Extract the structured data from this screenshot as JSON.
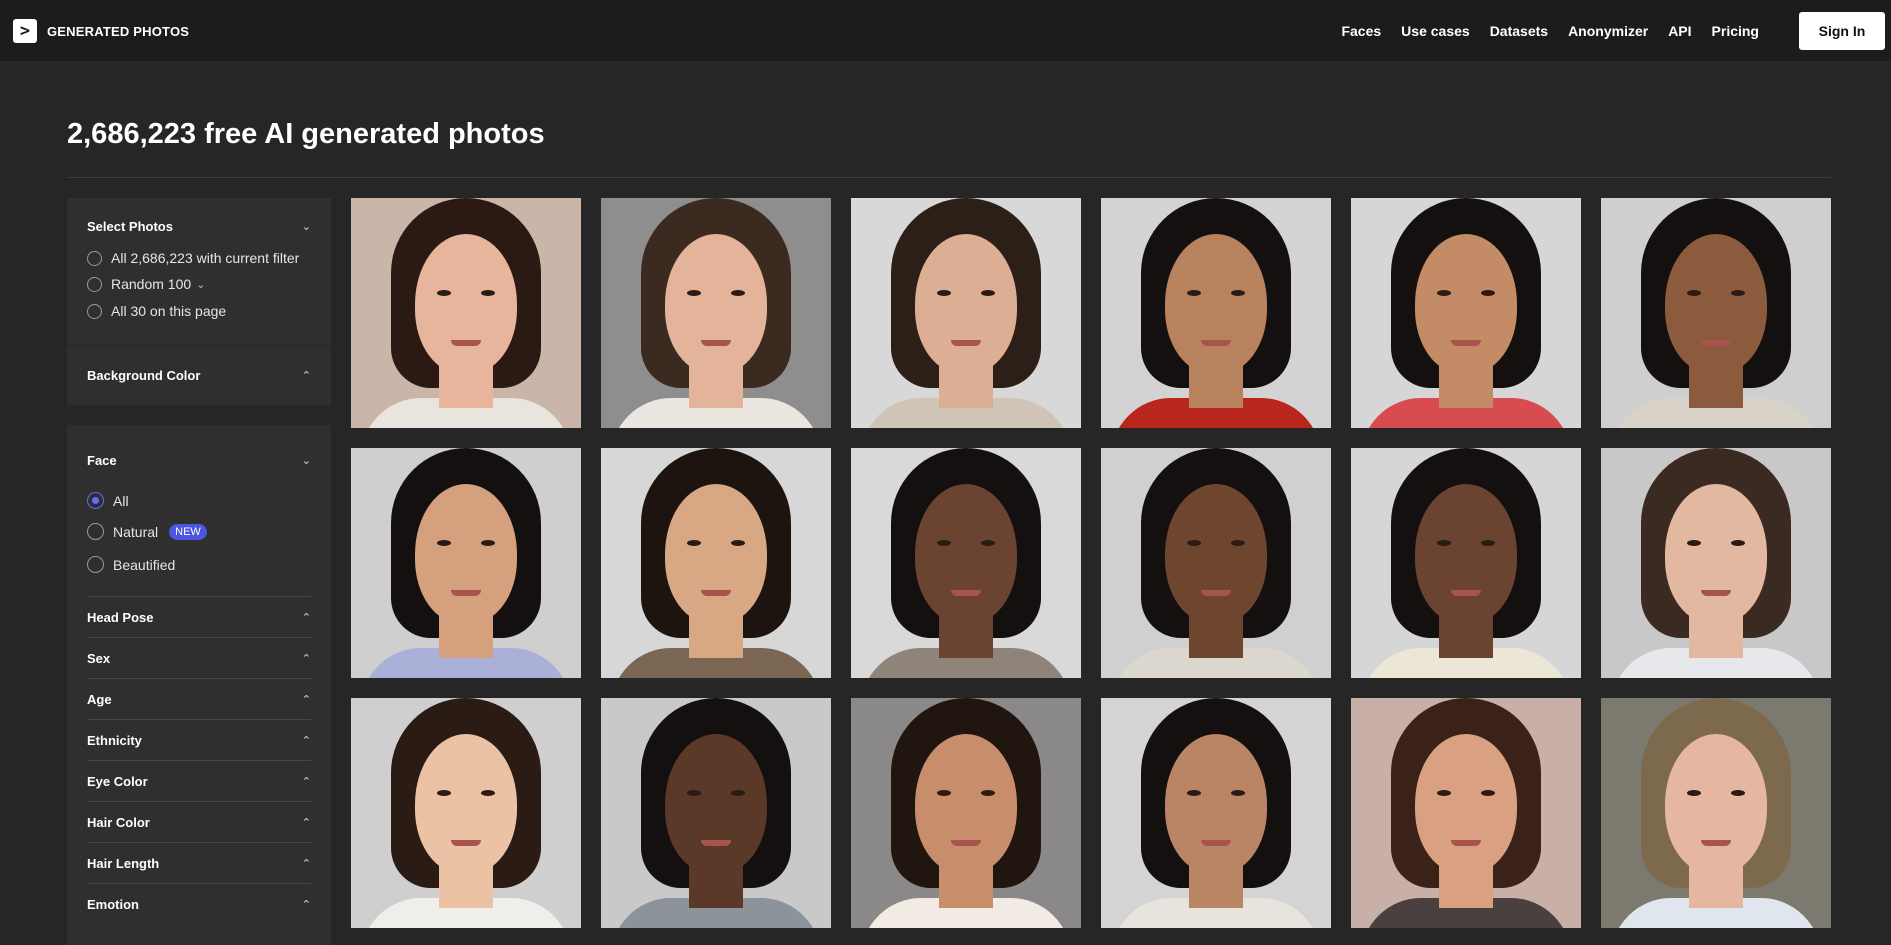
{
  "header": {
    "logo_symbol": ">",
    "logo_text": "GENERATED PHOTOS",
    "nav": [
      "Faces",
      "Use cases",
      "Datasets",
      "Anonymizer",
      "API",
      "Pricing"
    ],
    "signin_label": "Sign In"
  },
  "main": {
    "title": "2,686,223 free AI generated photos"
  },
  "sidebar": {
    "select_photos": {
      "title": "Select Photos",
      "options": [
        "All 2,686,223 with current filter",
        "Random 100",
        "All 30 on this page"
      ]
    },
    "background_color": {
      "title": "Background Color"
    },
    "face": {
      "title": "Face",
      "options": [
        "All",
        "Natural",
        "Beautified"
      ],
      "selected": "All",
      "new_badge": "NEW"
    },
    "filters": [
      "Head Pose",
      "Sex",
      "Age",
      "Ethnicity",
      "Eye Color",
      "Hair Color",
      "Hair Length",
      "Emotion"
    ]
  },
  "colors": {
    "background": "#262626",
    "topbar": "#1c1c1c",
    "panel": "#2f2f2f",
    "accent": "#5b6cff"
  },
  "photos": [
    {
      "bg": "#c9b6a8",
      "hair": "#2b1a14",
      "skin": "#e7b59c",
      "shirt": "#e9e4de"
    },
    {
      "bg": "#8e8e8e",
      "hair": "#3a2a20",
      "skin": "#e4b49a",
      "shirt": "#ebe6df"
    },
    {
      "bg": "#d8d8d8",
      "hair": "#2b1f18",
      "skin": "#dcae94",
      "shirt": "#cfc4b5"
    },
    {
      "bg": "#d3d3d3",
      "hair": "#141010",
      "skin": "#b8825f",
      "shirt": "#b8261d"
    },
    {
      "bg": "#d6d6d6",
      "hair": "#141010",
      "skin": "#c48c66",
      "shirt": "#d84b4f"
    },
    {
      "bg": "#cfcfcf",
      "hair": "#141010",
      "skin": "#8c5a3c",
      "shirt": "#d9d2c8"
    },
    {
      "bg": "#cfcfcf",
      "hair": "#141010",
      "skin": "#d4a07e",
      "shirt": "#aab0d8"
    },
    {
      "bg": "#d7d7d7",
      "hair": "#1d1410",
      "skin": "#d8a885",
      "shirt": "#7b6654"
    },
    {
      "bg": "#d9d9d9",
      "hair": "#141010",
      "skin": "#6b4431",
      "shirt": "#8f8479"
    },
    {
      "bg": "#d0d0d0",
      "hair": "#141010",
      "skin": "#6e4630",
      "shirt": "#dcd8d0"
    },
    {
      "bg": "#d6d6d6",
      "hair": "#141010",
      "skin": "#6a4331",
      "shirt": "#ece6d6"
    },
    {
      "bg": "#c8c8c8",
      "hair": "#3b2a22",
      "skin": "#e3b8a0",
      "shirt": "#e7e8ec"
    },
    {
      "bg": "#cfcfcf",
      "hair": "#2a1b14",
      "skin": "#ecc2a5",
      "shirt": "#f0eeea"
    },
    {
      "bg": "#c9c9c9",
      "hair": "#141010",
      "skin": "#5b3928",
      "shirt": "#8d939b"
    },
    {
      "bg": "#8a8888",
      "hair": "#20150f",
      "skin": "#c88e6b",
      "shirt": "#f2ebe3"
    },
    {
      "bg": "#d4d4d4",
      "hair": "#141010",
      "skin": "#b98565",
      "shirt": "#e7e3dd"
    },
    {
      "bg": "#c8b0a8",
      "hair": "#3a2218",
      "skin": "#d9a082",
      "shirt": "#4a4040"
    },
    {
      "bg": "#7c7a6e",
      "hair": "#7d6a4e",
      "skin": "#e5b7a0",
      "shirt": "#dfe6ee"
    }
  ]
}
